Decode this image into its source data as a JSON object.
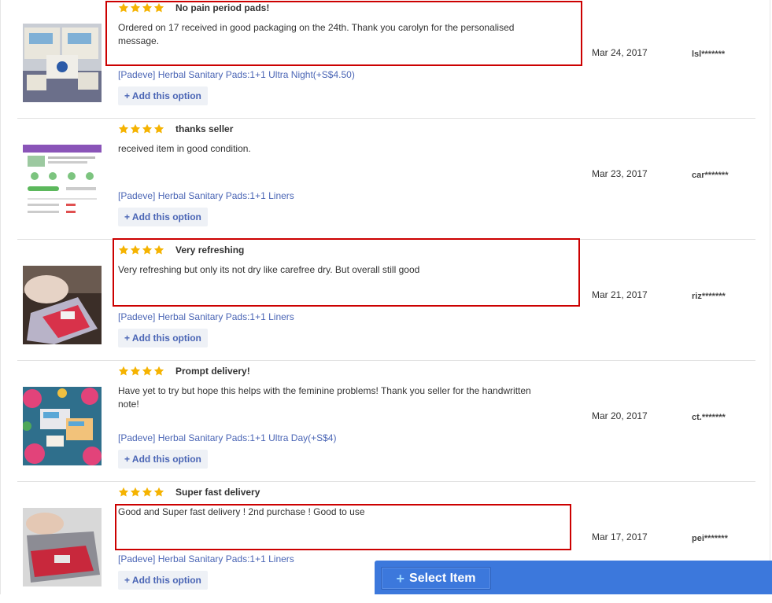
{
  "colors": {
    "star": "#f5b301",
    "link": "#4a65b5",
    "highlight": "#cc0000",
    "select_bar": "#3c78dc"
  },
  "reviews": [
    {
      "rating": 4,
      "title": "No pain period pads!",
      "text": "Ordered on 17 received in good packaging on the 24th. Thank you carolyn for the personalised message.",
      "option": "[Padeve] Herbal Sanitary Pads:1+1 Ultra Night(+S$4.50)",
      "add_label": "+ Add this option",
      "date": "Mar 24, 2017",
      "user": "lsl*******",
      "image": "product-boxes-photo"
    },
    {
      "rating": 4,
      "title": "thanks seller",
      "text": "received item in good condition.",
      "option": "[Padeve] Herbal Sanitary Pads:1+1 Liners",
      "add_label": "+ Add this option",
      "date": "Mar 23, 2017",
      "user": "car*******",
      "image": "app-screenshot"
    },
    {
      "rating": 4,
      "title": "Very refreshing",
      "text": "Very refreshing but only its not dry like carefree dry. But overall still good",
      "option": "[Padeve] Herbal Sanitary Pads:1+1 Liners",
      "add_label": "+ Add this option",
      "date": "Mar 21, 2017",
      "user": "riz*******",
      "image": "hand-holding-pack-photo"
    },
    {
      "rating": 4,
      "title": "Prompt delivery!",
      "text": "Have yet to try but hope this helps with the feminine problems! Thank you seller for the handwritten note!",
      "option": "[Padeve] Herbal Sanitary Pads:1+1 Ultra Day(+S$4)",
      "add_label": "+ Add this option",
      "date": "Mar 20, 2017",
      "user": "ct.*******",
      "image": "floral-fabric-photo"
    },
    {
      "rating": 4,
      "title": "Super fast delivery",
      "text": "Good and Super fast delivery ! 2nd purchase ! Good to use",
      "option": "[Padeve] Herbal Sanitary Pads:1+1 Liners",
      "add_label": "+ Add this option",
      "date": "Mar 17, 2017",
      "user": "pei*******",
      "image": "hand-holding-pack-photo"
    }
  ],
  "select_bar": {
    "button_label": "Select Item",
    "icon": "plus-icon"
  }
}
